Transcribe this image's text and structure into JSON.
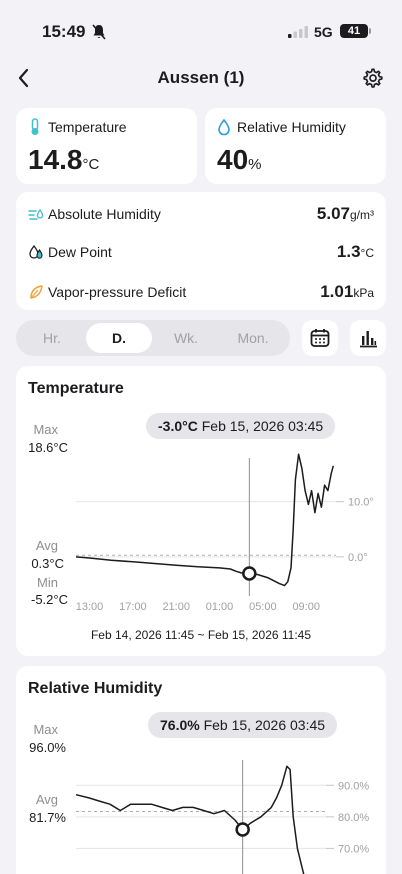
{
  "status": {
    "time": "15:49",
    "network": "5G",
    "battery": "41"
  },
  "nav": {
    "title": "Aussen (1)"
  },
  "temperature_card": {
    "label": "Temperature",
    "value": "14.8",
    "unit": "°C"
  },
  "humidity_card": {
    "label": "Relative Humidity",
    "value": "40",
    "unit": "%"
  },
  "metrics": [
    {
      "label": "Absolute Humidity",
      "value": "5.07",
      "unit": "g/m³",
      "icon": "wind-drop-icon"
    },
    {
      "label": "Dew Point",
      "value": "1.3",
      "unit": "°C",
      "icon": "drops-icon"
    },
    {
      "label": "Vapor-pressure Deficit",
      "value": "1.01",
      "unit": "kPa",
      "icon": "leaf-icon"
    }
  ],
  "period_tabs": [
    {
      "label": "Hr.",
      "active": false
    },
    {
      "label": "D.",
      "active": true
    },
    {
      "label": "Wk.",
      "active": false
    },
    {
      "label": "Mon.",
      "active": false
    }
  ],
  "colors": {
    "accent_teal": "#3ec1c9",
    "accent_blue": "#2f9ee6",
    "accent_orange": "#f0a030",
    "line": "#1c1c1e"
  },
  "chart_data": [
    {
      "type": "line",
      "title": "Temperature",
      "tooltip_value": "-3.0°C",
      "tooltip_time": "Feb 15, 2026 03:45",
      "max_label": "Max",
      "max_value": "18.6°C",
      "avg_label": "Avg",
      "avg_value": "0.3°C",
      "min_label": "Min",
      "min_value": "-5.2°C",
      "x_ticks": [
        "13:00",
        "17:00",
        "21:00",
        "01:00",
        "05:00",
        "09:00"
      ],
      "x_tick_hours": [
        13,
        17,
        21,
        25,
        29,
        33
      ],
      "y_ticks": [
        "10.0°",
        "0.0°"
      ],
      "y_tick_values": [
        10,
        0
      ],
      "range_label": "Feb 14, 2026 11:45 ~ Feb 15, 2026 11:45",
      "x_hours": [
        11.75,
        13,
        15,
        17,
        19,
        21,
        23,
        25,
        26,
        26.5,
        27,
        27.75,
        28.5,
        29.5,
        30.5,
        31,
        31.3,
        31.6,
        31.8,
        32,
        32.3,
        32.6,
        32.9,
        33.2,
        33.5,
        33.8,
        34.1,
        34.4,
        34.7,
        35,
        35.3,
        35.5
      ],
      "y": [
        0.0,
        -0.2,
        -0.6,
        -0.9,
        -1.2,
        -1.5,
        -1.8,
        -2.0,
        -2.2,
        -2.6,
        -2.9,
        -3.0,
        -3.2,
        -3.8,
        -4.8,
        -5.2,
        -4.5,
        -2.0,
        5.0,
        14.0,
        18.6,
        16.0,
        12.0,
        9.5,
        12.0,
        8.0,
        11.5,
        9.0,
        13.0,
        12.0,
        15.0,
        16.5
      ],
      "ylim": [
        -6,
        19
      ],
      "selected_hour": 27.75,
      "selected_value": -3.0,
      "avg_value_num": 0.3
    },
    {
      "type": "line",
      "title": "Relative Humidity",
      "tooltip_value": "76.0%",
      "tooltip_time": "Feb 15, 2026 03:45",
      "max_label": "Max",
      "max_value": "96.0%",
      "avg_label": "Avg",
      "avg_value": "81.7%",
      "y_ticks": [
        "90.0%",
        "80.0%",
        "70.0%"
      ],
      "y_tick_values": [
        90,
        80,
        70
      ],
      "x_hours": [
        11.75,
        13,
        14,
        15,
        16,
        17,
        18,
        19,
        20,
        21,
        22,
        23,
        24,
        25,
        26,
        27,
        27.75,
        28.5,
        29.5,
        30.5,
        31,
        31.5,
        32,
        32.3,
        32.6,
        33,
        33.3,
        33.6,
        34
      ],
      "y": [
        87,
        86,
        85,
        84,
        82,
        84,
        84,
        84,
        83,
        82,
        83,
        83,
        82,
        81,
        82,
        79,
        76,
        78,
        80,
        83,
        86,
        90,
        96,
        95,
        80,
        70,
        66,
        62,
        58
      ],
      "ylim": [
        60,
        98
      ],
      "selected_hour": 27.75,
      "selected_value": 76.0,
      "avg_value_num": 81.7
    }
  ]
}
